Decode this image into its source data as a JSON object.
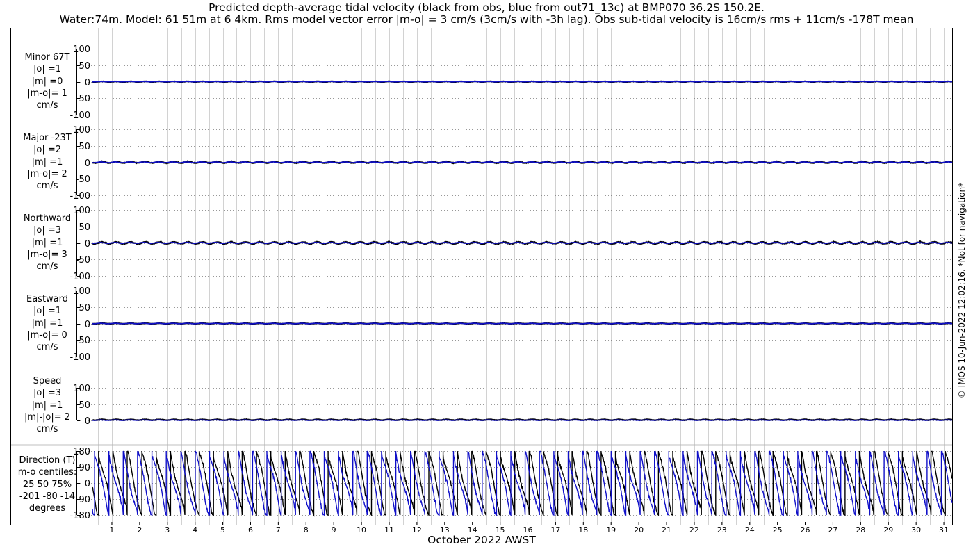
{
  "titles": {
    "line1": "Predicted depth-average tidal velocity (black from obs, blue from out71_13c) at BMP070 36.2S 150.2E.",
    "line2": "Water:74m. Model: 61 51m at 6 4km. Rms model vector error |m-o| = 3 cm/s (3cm/s with -3h lag). Obs sub-tidal velocity is 16cm/s rms + 11cm/s -178T mean"
  },
  "copyright": "© IMOS 10-Jun-2022 12:02:16. *Not for navigation*",
  "colors": {
    "obs": "#000000",
    "model": "#1010c8",
    "grid": "#b4b4b4",
    "frame": "#000000"
  },
  "chart_data": [
    {
      "type": "line",
      "panel": "minor",
      "label_lines": [
        "Minor 67T",
        "|o| =1",
        "|m| =0",
        "|m-o|= 1",
        "cm/s"
      ],
      "ylim": [
        -100,
        100
      ],
      "yticks": [
        100,
        50,
        0,
        -50,
        -100
      ],
      "grid": true,
      "series": [
        {
          "name": "obs",
          "color": "#000000",
          "amplitude": 1,
          "offset": 0
        },
        {
          "name": "model",
          "color": "#1010c8",
          "amplitude": 0.5,
          "offset": 0
        }
      ]
    },
    {
      "type": "line",
      "panel": "major",
      "label_lines": [
        "Major -23T",
        "|o| =2",
        "|m| =1",
        "|m-o|= 2",
        "cm/s"
      ],
      "ylim": [
        -100,
        100
      ],
      "yticks": [
        100,
        50,
        0,
        -50,
        -100
      ],
      "grid": true,
      "series": [
        {
          "name": "obs",
          "color": "#000000",
          "amplitude": 2,
          "offset": 0
        },
        {
          "name": "model",
          "color": "#1010c8",
          "amplitude": 1.2,
          "offset": 0
        }
      ]
    },
    {
      "type": "line",
      "panel": "northward",
      "label_lines": [
        "Northward",
        "|o| =3",
        "|m| =1",
        "|m-o|= 3",
        "cm/s"
      ],
      "ylim": [
        -100,
        100
      ],
      "yticks": [
        100,
        50,
        0,
        -50,
        -100
      ],
      "grid": true,
      "series": [
        {
          "name": "obs",
          "color": "#000000",
          "amplitude": 2.5,
          "offset": 0
        },
        {
          "name": "model",
          "color": "#1010c8",
          "amplitude": 1.2,
          "offset": 0
        }
      ]
    },
    {
      "type": "line",
      "panel": "eastward",
      "label_lines": [
        "Eastward",
        "|o| =1",
        "|m| =1",
        "|m-o|= 0",
        "cm/s"
      ],
      "ylim": [
        -100,
        100
      ],
      "yticks": [
        100,
        50,
        0,
        -50,
        -100
      ],
      "grid": true,
      "series": [
        {
          "name": "obs",
          "color": "#000000",
          "amplitude": 0.8,
          "offset": 0
        },
        {
          "name": "model",
          "color": "#1010c8",
          "amplitude": 0.8,
          "offset": 0
        }
      ]
    },
    {
      "type": "line",
      "panel": "speed",
      "label_lines": [
        "Speed",
        "|o| =3",
        "|m| =1",
        "|m|-|o|= 2",
        "cm/s"
      ],
      "ylim": [
        0,
        100
      ],
      "yticks": [
        100,
        50,
        0
      ],
      "grid": true,
      "series": [
        {
          "name": "obs",
          "color": "#000000",
          "amplitude": 1.2,
          "offset": 2
        },
        {
          "name": "model",
          "color": "#1010c8",
          "amplitude": 0.6,
          "offset": 1
        }
      ]
    },
    {
      "type": "line",
      "panel": "direction",
      "label_lines": [
        "Direction (T)",
        "m-o centiles:",
        "25  50  75%",
        "-201  -80  -14",
        "degrees"
      ],
      "ylim": [
        -180,
        180
      ],
      "yticks": [
        180,
        90,
        0,
        -90,
        -180
      ],
      "grid": true,
      "tidal_period_days": 0.5175,
      "series": [
        {
          "name": "obs",
          "color": "#000000",
          "phase": 0.0
        },
        {
          "name": "model",
          "color": "#1010c8",
          "phase": 0.28
        }
      ]
    }
  ],
  "x_axis": {
    "label": "October 2022 AWST",
    "xlim": [
      0.3,
      31.3
    ],
    "ticks": [
      1,
      2,
      3,
      4,
      5,
      6,
      7,
      8,
      9,
      10,
      11,
      12,
      13,
      14,
      15,
      16,
      17,
      18,
      19,
      20,
      21,
      22,
      23,
      24,
      25,
      26,
      27,
      28,
      29,
      30,
      31
    ],
    "minor_grid_step": 0.5
  }
}
